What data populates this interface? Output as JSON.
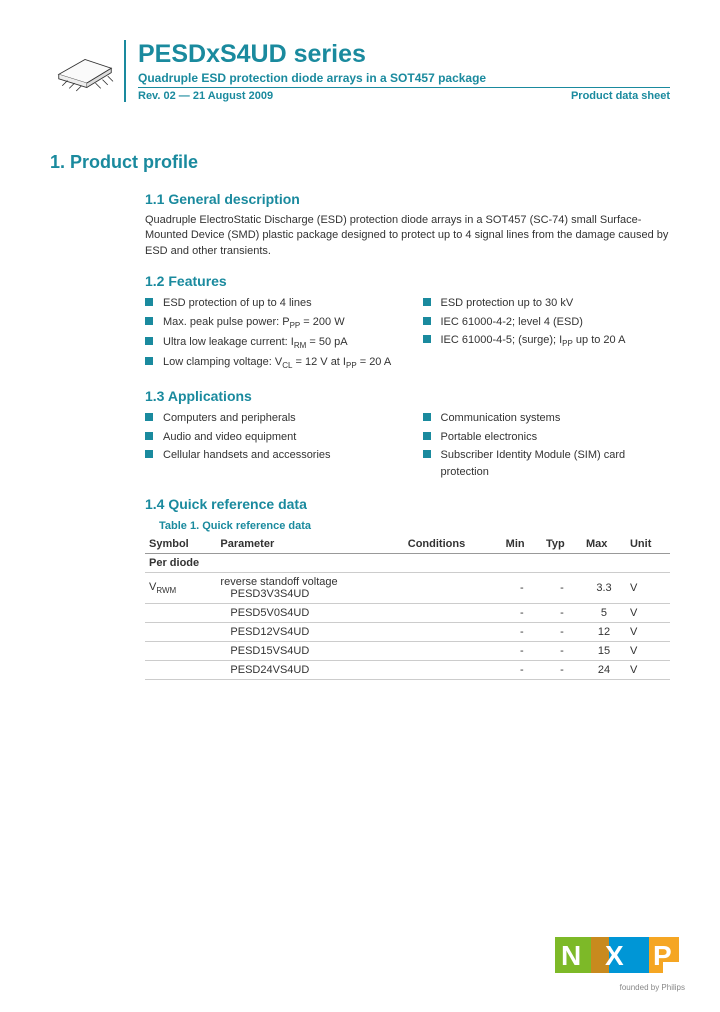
{
  "header": {
    "title": "PESDxS4UD series",
    "subtitle": "Quadruple ESD protection diode arrays in a SOT457 package",
    "rev": "Rev. 02 — 21 August 2009",
    "doctype": "Product data sheet"
  },
  "section1": {
    "heading": "1.   Product profile",
    "s11": {
      "heading": "1.1  General description",
      "text": "Quadruple ElectroStatic Discharge (ESD) protection diode arrays in a SOT457 (SC-74) small Surface-Mounted Device (SMD) plastic package designed to protect up to 4 signal lines from the damage caused by ESD and other transients."
    },
    "s12": {
      "heading": "1.2  Features",
      "left": [
        "ESD protection of up to 4 lines",
        "Max. peak pulse power: P<sub>PP</sub> = 200 W",
        "Ultra low leakage current: I<sub>RM</sub> = 50 pA",
        "Low clamping voltage: V<sub>CL</sub> = 12 V at I<sub>PP</sub> = 20 A"
      ],
      "right": [
        "ESD protection up to 30 kV",
        "IEC 61000-4-2; level 4 (ESD)",
        "IEC 61000-4-5; (surge); I<sub>PP</sub> up to 20 A"
      ]
    },
    "s13": {
      "heading": "1.3  Applications",
      "left": [
        "Computers and peripherals",
        "Audio and video equipment",
        "Cellular handsets and accessories"
      ],
      "right": [
        "Communication systems",
        "Portable electronics",
        "Subscriber Identity Module (SIM) card protection"
      ]
    },
    "s14": {
      "heading": "1.4  Quick reference data",
      "table_title": "Table 1.     Quick reference data",
      "columns": [
        "Symbol",
        "Parameter",
        "Conditions",
        "Min",
        "Typ",
        "Max",
        "Unit"
      ],
      "perdiode": "Per diode",
      "symbol": "V<sub>RWM</sub>",
      "param_label": "reverse standoff voltage",
      "rows": [
        {
          "part": "PESD3V3S4UD",
          "min": "-",
          "typ": "-",
          "max": "3.3",
          "unit": "V"
        },
        {
          "part": "PESD5V0S4UD",
          "min": "-",
          "typ": "-",
          "max": "5",
          "unit": "V"
        },
        {
          "part": "PESD12VS4UD",
          "min": "-",
          "typ": "-",
          "max": "12",
          "unit": "V"
        },
        {
          "part": "PESD15VS4UD",
          "min": "-",
          "typ": "-",
          "max": "15",
          "unit": "V"
        },
        {
          "part": "PESD24VS4UD",
          "min": "-",
          "typ": "-",
          "max": "24",
          "unit": "V"
        }
      ]
    }
  },
  "footer": {
    "tagline": "founded by Philips"
  }
}
